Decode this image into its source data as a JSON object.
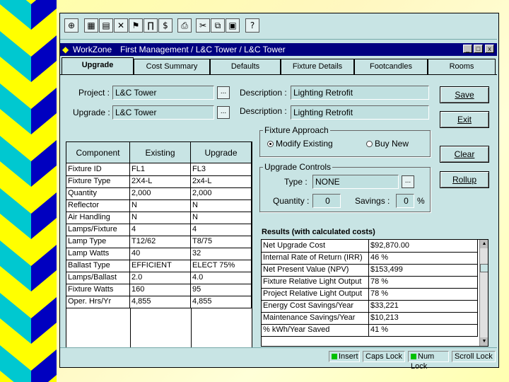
{
  "toolbar": {
    "icons": [
      "nav-icon",
      "calc-icon",
      "chart-icon",
      "tools-icon",
      "flag-icon",
      "fixture-icon",
      "dollar-icon",
      "print-icon",
      "cut-icon",
      "copy-icon",
      "paste-icon",
      "help-icon"
    ],
    "help_label": "?"
  },
  "title": {
    "app": "WorkZone",
    "path": "First Management / L&C Tower / L&C Tower",
    "minimize": "_",
    "maximize": "□",
    "close": "x"
  },
  "tabs": [
    "Upgrade",
    "Cost Summary",
    "Defaults",
    "Fixture Details",
    "Footcandles",
    "Rooms"
  ],
  "form": {
    "project_label": "Project :",
    "project_value": "L&C Tower",
    "upgrade_label": "Upgrade :",
    "upgrade_value": "L&C Tower",
    "browse": "...",
    "desc1_label": "Description :",
    "desc1_value": "Lighting Retrofit",
    "desc2_label": "Description :",
    "desc2_value": "Lighting Retrofit"
  },
  "buttons": {
    "save": "Save",
    "exit": "Exit",
    "clear": "Clear",
    "rollup": "Rollup"
  },
  "component_grid": {
    "headers": [
      "Component",
      "Existing",
      "Upgrade"
    ],
    "rows": [
      [
        "Fixture ID",
        "FL1",
        "FL3"
      ],
      [
        "Fixture Type",
        "2X4-L",
        "2x4-L"
      ],
      [
        "Quantity",
        "2,000",
        "2,000"
      ],
      [
        "Reflector",
        "N",
        "N"
      ],
      [
        "Air Handling",
        "N",
        "N"
      ],
      [
        "Lamps/Fixture",
        "4",
        "4"
      ],
      [
        "Lamp Type",
        "T12/62",
        "T8/75"
      ],
      [
        "Lamp Watts",
        "40",
        "32"
      ],
      [
        "Ballast Type",
        "EFFICIENT",
        "ELECT 75%"
      ],
      [
        "Lamps/Ballast",
        "2.0",
        "4.0"
      ],
      [
        "Fixture Watts",
        "160",
        "95"
      ],
      [
        "Oper. Hrs/Yr",
        "4,855",
        "4,855"
      ]
    ]
  },
  "fixture_approach": {
    "title": "Fixture Approach",
    "modify": "Modify Existing",
    "buy": "Buy New"
  },
  "upgrade_controls": {
    "title": "Upgrade Controls",
    "type_label": "Type :",
    "type_value": "NONE",
    "quantity_label": "Quantity :",
    "quantity_value": "0",
    "savings_label": "Savings :",
    "savings_value": "0",
    "percent": "%"
  },
  "results": {
    "title": "Results (with calculated costs)",
    "rows": [
      [
        "Net Upgrade Cost",
        "$92,870.00"
      ],
      [
        "Internal Rate of Return (IRR)",
        "46 %"
      ],
      [
        "Net Present Value (NPV)",
        "$153,499"
      ],
      [
        "Fixture Relative Light Output",
        "78 %"
      ],
      [
        "Project Relative Light Output",
        "78 %"
      ],
      [
        "Energy Cost Savings/Year",
        "$33,221"
      ],
      [
        "Maintenance Savings/Year",
        "$10,213"
      ],
      [
        "% kWh/Year Saved",
        "41 %"
      ]
    ]
  },
  "status": {
    "insert": "Insert",
    "caps": "Caps Lock",
    "num": "Num Lock",
    "scroll": "Scroll Lock"
  },
  "colors": {
    "background": "#ffffa8",
    "stripe": "#ffff00",
    "chevron_cyan": "#00c8d0",
    "chevron_blue": "#0000c0",
    "window": "#c8e4e4",
    "titlebar": "#000080"
  }
}
